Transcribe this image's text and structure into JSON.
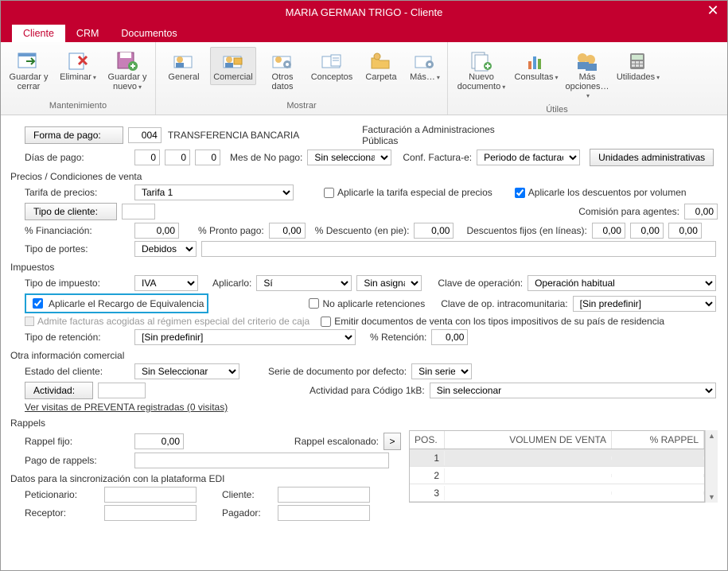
{
  "window": {
    "title": "MARIA GERMAN TRIGO - Cliente"
  },
  "tabs": {
    "cliente": "Cliente",
    "crm": "CRM",
    "documentos": "Documentos"
  },
  "ribbon": {
    "group1_title": "Mantenimiento",
    "g1_save_close": "Guardar y cerrar",
    "g1_delete": "Eliminar",
    "g1_save_new": "Guardar y nuevo",
    "group2_title": "Mostrar",
    "g2_general": "General",
    "g2_comercial": "Comercial",
    "g2_otros": "Otros datos",
    "g2_conceptos": "Conceptos",
    "g2_carpeta": "Carpeta",
    "g2_mas": "Más…",
    "group3_title": "Útiles",
    "g3_nuevo_doc": "Nuevo documento",
    "g3_consultas": "Consultas",
    "g3_mas_opc": "Más opciones…",
    "g3_utilidades": "Utilidades"
  },
  "forma_pago": {
    "label": "Forma de pago:",
    "code": "004",
    "desc": "TRANSFERENCIA BANCARIA"
  },
  "fact_aapp_label": "Facturación a Administraciones Públicas",
  "dias_pago": {
    "label": "Días de pago:",
    "v1": "0",
    "v2": "0",
    "v3": "0"
  },
  "mes_no_pago": {
    "label": "Mes de No pago:",
    "value": "Sin seleccionar"
  },
  "conf_factura_e": {
    "label": "Conf. Factura-e:",
    "value": "Periodo de facturaci"
  },
  "btn_unidades": "Unidades administrativas",
  "sec_precios": "Precios / Condiciones de venta",
  "tarifa": {
    "label": "Tarifa de precios:",
    "value": "Tarifa 1"
  },
  "chk_tarifa_esp": "Aplicarle la tarifa especial de precios",
  "chk_desc_vol": "Aplicarle los descuentos por volumen",
  "tipo_cliente_label": "Tipo de cliente:",
  "comision_label": "Comisión para agentes:",
  "comision_value": "0,00",
  "pct_fin": {
    "label": "% Financiación:",
    "value": "0,00"
  },
  "pct_pronto": {
    "label": "% Pronto pago:",
    "value": "0,00"
  },
  "pct_desc_pie": {
    "label": "% Descuento (en pie):",
    "value": "0,00"
  },
  "desc_fijos": {
    "label": "Descuentos fijos (en líneas):",
    "v1": "0,00",
    "v2": "0,00",
    "v3": "0,00"
  },
  "tipo_portes": {
    "label": "Tipo de portes:",
    "value": "Debidos"
  },
  "sec_impuestos": "Impuestos",
  "tipo_imp": {
    "label": "Tipo de impuesto:",
    "value": "IVA"
  },
  "aplicarlo": {
    "label": "Aplicarlo:",
    "value": "Sí",
    "extra": "Sin asignar"
  },
  "clave_op": {
    "label": "Clave de operación:",
    "value": "Operación habitual"
  },
  "chk_recargo": "Aplicarle el Recargo de Equivalencia",
  "chk_no_ret": "No aplicarle retenciones",
  "clave_intra": {
    "label": "Clave de op. intracomunitaria:",
    "value": "[Sin predefinir]"
  },
  "chk_regimen": "Admite facturas acogidas al régimen especial del criterio de caja",
  "chk_emitir": "Emitir documentos de venta con los tipos impositivos de su país de residencia",
  "tipo_ret": {
    "label": "Tipo de retención:",
    "value": "[Sin predefinir]"
  },
  "pct_ret": {
    "label": "% Retención:",
    "value": "0,00"
  },
  "sec_otra": "Otra información comercial",
  "estado": {
    "label": "Estado del cliente:",
    "value": "Sin Seleccionar"
  },
  "serie": {
    "label": "Serie de documento por defecto:",
    "value": "Sin serie"
  },
  "actividad_label": "Actividad:",
  "actividad_1kb": {
    "label": "Actividad para Código 1kB:",
    "value": "Sin seleccionar"
  },
  "link_visitas": "Ver visitas de PREVENTA registradas (0 visitas)",
  "sec_rappels": "Rappels",
  "rappel_fijo": {
    "label": "Rappel fijo:",
    "value": "0,00"
  },
  "rappel_esc_label": "Rappel escalonado:",
  "pago_rappels_label": "Pago de rappels:",
  "rappel_table": {
    "h_pos": "POS.",
    "h_vol": "VOLUMEN DE VENTA",
    "h_pct": "% RAPPEL",
    "r1": "1",
    "r2": "2",
    "r3": "3"
  },
  "sec_edi": "Datos para la sincronización con la plataforma EDI",
  "peticionario_label": "Peticionario:",
  "cliente_edi_label": "Cliente:",
  "receptor_label": "Receptor:",
  "pagador_label": "Pagador:"
}
